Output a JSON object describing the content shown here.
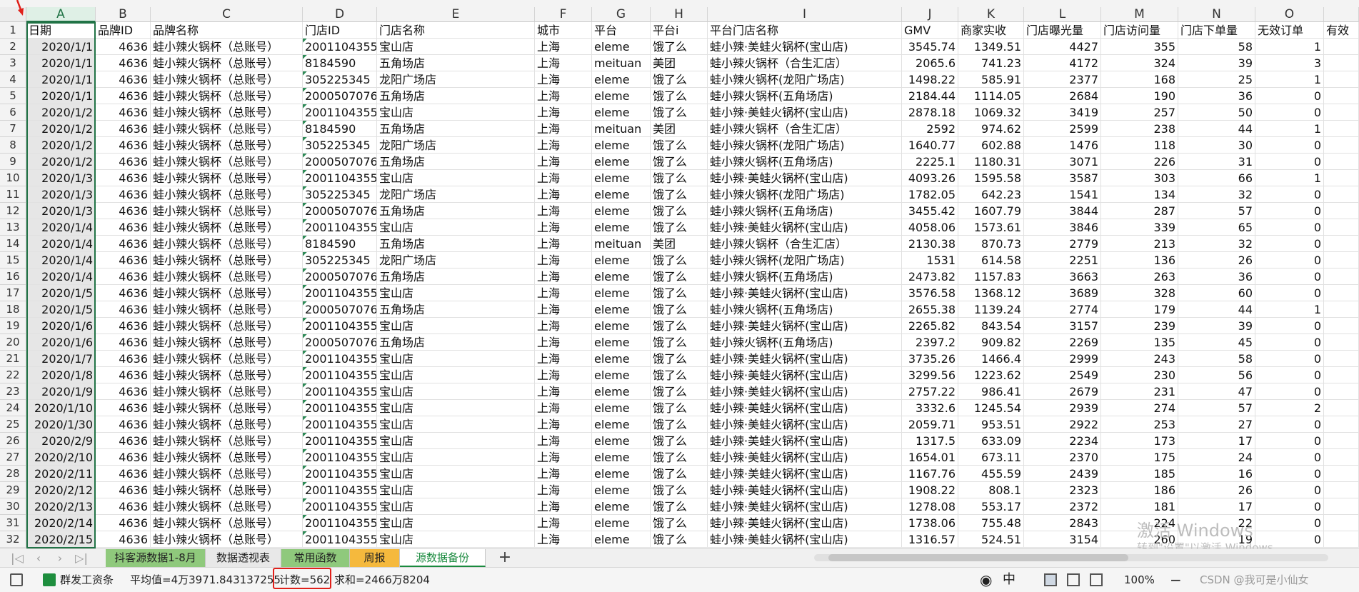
{
  "columns": [
    {
      "letter": "A",
      "width": 97,
      "header": "日期",
      "num": true
    },
    {
      "letter": "B",
      "width": 77,
      "header": "品牌ID",
      "num": true
    },
    {
      "letter": "C",
      "width": 213,
      "header": "品牌名称",
      "num": false
    },
    {
      "letter": "D",
      "width": 104,
      "header": "门店ID",
      "num": false,
      "tri": true
    },
    {
      "letter": "E",
      "width": 221,
      "header": "门店名称",
      "num": false
    },
    {
      "letter": "F",
      "width": 80,
      "header": "城市",
      "num": false
    },
    {
      "letter": "G",
      "width": 82,
      "header": "平台",
      "num": false
    },
    {
      "letter": "H",
      "width": 80,
      "header": "平台i",
      "num": false
    },
    {
      "letter": "I",
      "width": 272,
      "header": "平台门店名称",
      "num": false
    },
    {
      "letter": "J",
      "width": 79,
      "header": "GMV",
      "num": true
    },
    {
      "letter": "K",
      "width": 92,
      "header": "商家实收",
      "num": true
    },
    {
      "letter": "L",
      "width": 108,
      "header": "门店曝光量",
      "num": true
    },
    {
      "letter": "M",
      "width": 108,
      "header": "门店访问量",
      "num": true
    },
    {
      "letter": "N",
      "width": 108,
      "header": "门店下单量",
      "num": true
    },
    {
      "letter": "O",
      "width": 96,
      "header": "无效订单",
      "num": true
    },
    {
      "letter": "",
      "width": 49,
      "header": "有效",
      "num": false
    }
  ],
  "rows": [
    [
      "2020/1/1",
      "4636",
      "蛙小辣火锅杯（总账号）",
      "2001104355",
      "宝山店",
      "上海",
      "eleme",
      "饿了么",
      "蛙小辣·美蛙火锅杯(宝山店)",
      "3545.74",
      "1349.51",
      "4427",
      "355",
      "58",
      "1"
    ],
    [
      "2020/1/1",
      "4636",
      "蛙小辣火锅杯（总账号）",
      "8184590",
      "五角场店",
      "上海",
      "meituan",
      "美团",
      "蛙小辣火锅杯（合生汇店）",
      "2065.6",
      "741.23",
      "4172",
      "324",
      "39",
      "3"
    ],
    [
      "2020/1/1",
      "4636",
      "蛙小辣火锅杯（总账号）",
      "305225345",
      "龙阳广场店",
      "上海",
      "eleme",
      "饿了么",
      "蛙小辣火锅杯(龙阳广场店)",
      "1498.22",
      "585.91",
      "2377",
      "168",
      "25",
      "1"
    ],
    [
      "2020/1/1",
      "4636",
      "蛙小辣火锅杯（总账号）",
      "2000507076",
      "五角场店",
      "上海",
      "eleme",
      "饿了么",
      "蛙小辣火锅杯(五角场店)",
      "2184.44",
      "1114.05",
      "2684",
      "190",
      "36",
      "0"
    ],
    [
      "2020/1/2",
      "4636",
      "蛙小辣火锅杯（总账号）",
      "2001104355",
      "宝山店",
      "上海",
      "eleme",
      "饿了么",
      "蛙小辣·美蛙火锅杯(宝山店)",
      "2878.18",
      "1069.32",
      "3419",
      "257",
      "50",
      "0"
    ],
    [
      "2020/1/2",
      "4636",
      "蛙小辣火锅杯（总账号）",
      "8184590",
      "五角场店",
      "上海",
      "meituan",
      "美团",
      "蛙小辣火锅杯（合生汇店）",
      "2592",
      "974.62",
      "2599",
      "238",
      "44",
      "1"
    ],
    [
      "2020/1/2",
      "4636",
      "蛙小辣火锅杯（总账号）",
      "305225345",
      "龙阳广场店",
      "上海",
      "eleme",
      "饿了么",
      "蛙小辣火锅杯(龙阳广场店)",
      "1640.77",
      "602.88",
      "1476",
      "118",
      "30",
      "0"
    ],
    [
      "2020/1/2",
      "4636",
      "蛙小辣火锅杯（总账号）",
      "2000507076",
      "五角场店",
      "上海",
      "eleme",
      "饿了么",
      "蛙小辣火锅杯(五角场店)",
      "2225.1",
      "1180.31",
      "3071",
      "226",
      "31",
      "0"
    ],
    [
      "2020/1/3",
      "4636",
      "蛙小辣火锅杯（总账号）",
      "2001104355",
      "宝山店",
      "上海",
      "eleme",
      "饿了么",
      "蛙小辣·美蛙火锅杯(宝山店)",
      "4093.26",
      "1595.58",
      "3587",
      "303",
      "66",
      "1"
    ],
    [
      "2020/1/3",
      "4636",
      "蛙小辣火锅杯（总账号）",
      "305225345",
      "龙阳广场店",
      "上海",
      "eleme",
      "饿了么",
      "蛙小辣火锅杯(龙阳广场店)",
      "1782.05",
      "642.23",
      "1541",
      "134",
      "32",
      "0"
    ],
    [
      "2020/1/3",
      "4636",
      "蛙小辣火锅杯（总账号）",
      "2000507076",
      "五角场店",
      "上海",
      "eleme",
      "饿了么",
      "蛙小辣火锅杯(五角场店)",
      "3455.42",
      "1607.79",
      "3844",
      "287",
      "57",
      "0"
    ],
    [
      "2020/1/4",
      "4636",
      "蛙小辣火锅杯（总账号）",
      "2001104355",
      "宝山店",
      "上海",
      "eleme",
      "饿了么",
      "蛙小辣·美蛙火锅杯(宝山店)",
      "4058.06",
      "1573.61",
      "3846",
      "339",
      "65",
      "0"
    ],
    [
      "2020/1/4",
      "4636",
      "蛙小辣火锅杯（总账号）",
      "8184590",
      "五角场店",
      "上海",
      "meituan",
      "美团",
      "蛙小辣火锅杯（合生汇店）",
      "2130.38",
      "870.73",
      "2779",
      "213",
      "32",
      "0"
    ],
    [
      "2020/1/4",
      "4636",
      "蛙小辣火锅杯（总账号）",
      "305225345",
      "龙阳广场店",
      "上海",
      "eleme",
      "饿了么",
      "蛙小辣火锅杯(龙阳广场店)",
      "1531",
      "614.58",
      "2251",
      "136",
      "26",
      "0"
    ],
    [
      "2020/1/4",
      "4636",
      "蛙小辣火锅杯（总账号）",
      "2000507076",
      "五角场店",
      "上海",
      "eleme",
      "饿了么",
      "蛙小辣火锅杯(五角场店)",
      "2473.82",
      "1157.83",
      "3663",
      "263",
      "36",
      "0"
    ],
    [
      "2020/1/5",
      "4636",
      "蛙小辣火锅杯（总账号）",
      "2001104355",
      "宝山店",
      "上海",
      "eleme",
      "饿了么",
      "蛙小辣·美蛙火锅杯(宝山店)",
      "3576.58",
      "1368.12",
      "3689",
      "328",
      "60",
      "0"
    ],
    [
      "2020/1/5",
      "4636",
      "蛙小辣火锅杯（总账号）",
      "2000507076",
      "五角场店",
      "上海",
      "eleme",
      "饿了么",
      "蛙小辣火锅杯(五角场店)",
      "2655.38",
      "1139.24",
      "2774",
      "179",
      "44",
      "1"
    ],
    [
      "2020/1/6",
      "4636",
      "蛙小辣火锅杯（总账号）",
      "2001104355",
      "宝山店",
      "上海",
      "eleme",
      "饿了么",
      "蛙小辣·美蛙火锅杯(宝山店)",
      "2265.82",
      "843.54",
      "3157",
      "239",
      "39",
      "0"
    ],
    [
      "2020/1/6",
      "4636",
      "蛙小辣火锅杯（总账号）",
      "2000507076",
      "五角场店",
      "上海",
      "eleme",
      "饿了么",
      "蛙小辣火锅杯(五角场店)",
      "2397.2",
      "909.82",
      "2269",
      "135",
      "45",
      "0"
    ],
    [
      "2020/1/7",
      "4636",
      "蛙小辣火锅杯（总账号）",
      "2001104355",
      "宝山店",
      "上海",
      "eleme",
      "饿了么",
      "蛙小辣·美蛙火锅杯(宝山店)",
      "3735.26",
      "1466.4",
      "2999",
      "243",
      "58",
      "0"
    ],
    [
      "2020/1/8",
      "4636",
      "蛙小辣火锅杯（总账号）",
      "2001104355",
      "宝山店",
      "上海",
      "eleme",
      "饿了么",
      "蛙小辣·美蛙火锅杯(宝山店)",
      "3299.56",
      "1223.62",
      "2549",
      "230",
      "56",
      "0"
    ],
    [
      "2020/1/9",
      "4636",
      "蛙小辣火锅杯（总账号）",
      "2001104355",
      "宝山店",
      "上海",
      "eleme",
      "饿了么",
      "蛙小辣·美蛙火锅杯(宝山店)",
      "2757.22",
      "986.41",
      "2679",
      "231",
      "47",
      "0"
    ],
    [
      "2020/1/10",
      "4636",
      "蛙小辣火锅杯（总账号）",
      "2001104355",
      "宝山店",
      "上海",
      "eleme",
      "饿了么",
      "蛙小辣·美蛙火锅杯(宝山店)",
      "3332.6",
      "1245.54",
      "2939",
      "274",
      "57",
      "2"
    ],
    [
      "2020/1/30",
      "4636",
      "蛙小辣火锅杯（总账号）",
      "2001104355",
      "宝山店",
      "上海",
      "eleme",
      "饿了么",
      "蛙小辣·美蛙火锅杯(宝山店)",
      "2059.71",
      "953.51",
      "2922",
      "253",
      "27",
      "0"
    ],
    [
      "2020/2/9",
      "4636",
      "蛙小辣火锅杯（总账号）",
      "2001104355",
      "宝山店",
      "上海",
      "eleme",
      "饿了么",
      "蛙小辣·美蛙火锅杯(宝山店)",
      "1317.5",
      "633.09",
      "2234",
      "173",
      "17",
      "0"
    ],
    [
      "2020/2/10",
      "4636",
      "蛙小辣火锅杯（总账号）",
      "2001104355",
      "宝山店",
      "上海",
      "eleme",
      "饿了么",
      "蛙小辣·美蛙火锅杯(宝山店)",
      "1654.01",
      "673.11",
      "2370",
      "175",
      "24",
      "0"
    ],
    [
      "2020/2/11",
      "4636",
      "蛙小辣火锅杯（总账号）",
      "2001104355",
      "宝山店",
      "上海",
      "eleme",
      "饿了么",
      "蛙小辣·美蛙火锅杯(宝山店)",
      "1167.76",
      "455.59",
      "2439",
      "185",
      "16",
      "0"
    ],
    [
      "2020/2/12",
      "4636",
      "蛙小辣火锅杯（总账号）",
      "2001104355",
      "宝山店",
      "上海",
      "eleme",
      "饿了么",
      "蛙小辣·美蛙火锅杯(宝山店)",
      "1908.22",
      "808.1",
      "2323",
      "186",
      "26",
      "0"
    ],
    [
      "2020/2/13",
      "4636",
      "蛙小辣火锅杯（总账号）",
      "2001104355",
      "宝山店",
      "上海",
      "eleme",
      "饿了么",
      "蛙小辣·美蛙火锅杯(宝山店)",
      "1278.08",
      "553.17",
      "2372",
      "181",
      "17",
      "0"
    ],
    [
      "2020/2/14",
      "4636",
      "蛙小辣火锅杯（总账号）",
      "2001104355",
      "宝山店",
      "上海",
      "eleme",
      "饿了么",
      "蛙小辣·美蛙火锅杯(宝山店)",
      "1738.06",
      "755.48",
      "2843",
      "224",
      "22",
      "0"
    ],
    [
      "2020/2/15",
      "4636",
      "蛙小辣火锅杯（总账号）",
      "2001104355",
      "宝山店",
      "上海",
      "eleme",
      "饿了么",
      "蛙小辣·美蛙火锅杯(宝山店)",
      "1316.57",
      "524.51",
      "3154",
      "260",
      "19",
      "0"
    ]
  ],
  "sheet_tabs": [
    {
      "label": "抖客源数据1-8月",
      "color": "#8fc97c",
      "active": false
    },
    {
      "label": "数据透视表",
      "color": "#e8e8e8",
      "active": false
    },
    {
      "label": "常用函数",
      "color": "#8fc97c",
      "active": false
    },
    {
      "label": "周报",
      "color": "#f5b93d",
      "active": false
    },
    {
      "label": "源数据备份",
      "color": "#ffffff",
      "active": true
    }
  ],
  "status": {
    "macro_label": "群发工资条",
    "average": "平均值=4万3971.843137255",
    "count": "计数=562",
    "sum": "求和=2466万8204",
    "zoom": "100%",
    "credit": "CSDN @我可是小仙女"
  },
  "watermark": {
    "line1": "激活 Windows",
    "line2": "转到\"设置\"以激活 Windows。"
  },
  "colors": {
    "accent": "#217346",
    "highlight": "#e0201a",
    "active_tab": "#1a8a3e"
  }
}
